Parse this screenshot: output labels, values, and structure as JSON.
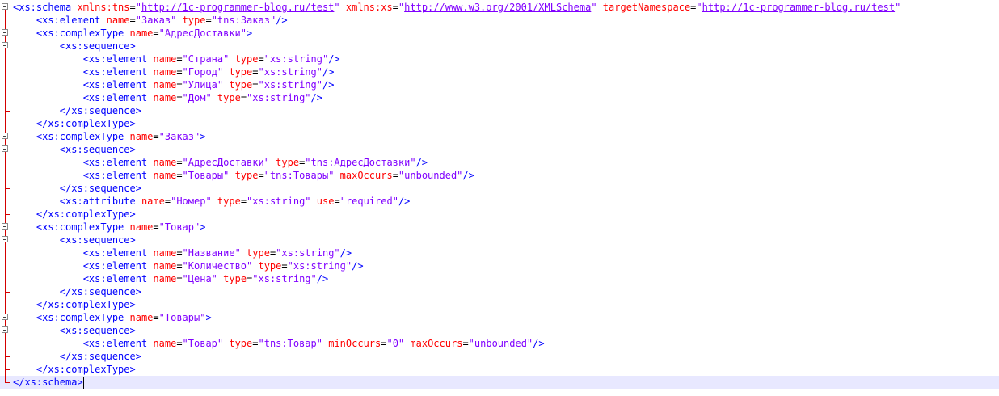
{
  "lines": [
    {
      "fold": "box-top",
      "indent": 0,
      "parts": [
        [
          "tag",
          "<xs:schema "
        ],
        [
          "attr",
          "xmlns:tns"
        ],
        [
          "eq",
          "="
        ],
        [
          "val",
          "\""
        ],
        [
          "url",
          "http://1c-programmer-blog.ru/test"
        ],
        [
          "val",
          "\""
        ],
        [
          "tag",
          " "
        ],
        [
          "attr",
          "xmlns:xs"
        ],
        [
          "eq",
          "="
        ],
        [
          "val",
          "\""
        ],
        [
          "url",
          "http://www.w3.org/2001/XMLSchema"
        ],
        [
          "val",
          "\""
        ],
        [
          "tag",
          " "
        ],
        [
          "attr",
          "targetNamespace"
        ],
        [
          "eq",
          "="
        ],
        [
          "val",
          "\""
        ],
        [
          "url",
          "http://1c-programmer-blog.ru/test"
        ],
        [
          "val",
          "\""
        ]
      ]
    },
    {
      "fold": "line",
      "indent": 4,
      "parts": [
        [
          "tag",
          "<xs:element "
        ],
        [
          "attr",
          "name"
        ],
        [
          "eq",
          "="
        ],
        [
          "val",
          "\"Заказ\""
        ],
        [
          "tag",
          " "
        ],
        [
          "attr",
          "type"
        ],
        [
          "eq",
          "="
        ],
        [
          "val",
          "\"tns:Заказ\""
        ],
        [
          "tag",
          "/>"
        ]
      ]
    },
    {
      "fold": "box",
      "indent": 4,
      "parts": [
        [
          "tag",
          "<xs:complexType "
        ],
        [
          "attr",
          "name"
        ],
        [
          "eq",
          "="
        ],
        [
          "val",
          "\"АдресДоставки\""
        ],
        [
          "tag",
          ">"
        ]
      ]
    },
    {
      "fold": "box",
      "indent": 8,
      "parts": [
        [
          "tag",
          "<xs:sequence>"
        ]
      ]
    },
    {
      "fold": "line",
      "indent": 12,
      "parts": [
        [
          "tag",
          "<xs:element "
        ],
        [
          "attr",
          "name"
        ],
        [
          "eq",
          "="
        ],
        [
          "val",
          "\"Страна\""
        ],
        [
          "tag",
          " "
        ],
        [
          "attr",
          "type"
        ],
        [
          "eq",
          "="
        ],
        [
          "val",
          "\"xs:string\""
        ],
        [
          "tag",
          "/>"
        ]
      ]
    },
    {
      "fold": "line",
      "indent": 12,
      "parts": [
        [
          "tag",
          "<xs:element "
        ],
        [
          "attr",
          "name"
        ],
        [
          "eq",
          "="
        ],
        [
          "val",
          "\"Город\""
        ],
        [
          "tag",
          " "
        ],
        [
          "attr",
          "type"
        ],
        [
          "eq",
          "="
        ],
        [
          "val",
          "\"xs:string\""
        ],
        [
          "tag",
          "/>"
        ]
      ]
    },
    {
      "fold": "line",
      "indent": 12,
      "parts": [
        [
          "tag",
          "<xs:element "
        ],
        [
          "attr",
          "name"
        ],
        [
          "eq",
          "="
        ],
        [
          "val",
          "\"Улица\""
        ],
        [
          "tag",
          " "
        ],
        [
          "attr",
          "type"
        ],
        [
          "eq",
          "="
        ],
        [
          "val",
          "\"xs:string\""
        ],
        [
          "tag",
          "/>"
        ]
      ]
    },
    {
      "fold": "line",
      "indent": 12,
      "parts": [
        [
          "tag",
          "<xs:element "
        ],
        [
          "attr",
          "name"
        ],
        [
          "eq",
          "="
        ],
        [
          "val",
          "\"Дом\""
        ],
        [
          "tag",
          " "
        ],
        [
          "attr",
          "type"
        ],
        [
          "eq",
          "="
        ],
        [
          "val",
          "\"xs:string\""
        ],
        [
          "tag",
          "/>"
        ]
      ]
    },
    {
      "fold": "end",
      "indent": 8,
      "parts": [
        [
          "tag",
          "</xs:sequence>"
        ]
      ]
    },
    {
      "fold": "end",
      "indent": 4,
      "parts": [
        [
          "tag",
          "</xs:complexType>"
        ]
      ]
    },
    {
      "fold": "box",
      "indent": 4,
      "parts": [
        [
          "tag",
          "<xs:complexType "
        ],
        [
          "attr",
          "name"
        ],
        [
          "eq",
          "="
        ],
        [
          "val",
          "\"Заказ\""
        ],
        [
          "tag",
          ">"
        ]
      ]
    },
    {
      "fold": "box",
      "indent": 8,
      "parts": [
        [
          "tag",
          "<xs:sequence>"
        ]
      ]
    },
    {
      "fold": "line",
      "indent": 12,
      "parts": [
        [
          "tag",
          "<xs:element "
        ],
        [
          "attr",
          "name"
        ],
        [
          "eq",
          "="
        ],
        [
          "val",
          "\"АдресДоставки\""
        ],
        [
          "tag",
          " "
        ],
        [
          "attr",
          "type"
        ],
        [
          "eq",
          "="
        ],
        [
          "val",
          "\"tns:АдресДоставки\""
        ],
        [
          "tag",
          "/>"
        ]
      ]
    },
    {
      "fold": "line",
      "indent": 12,
      "parts": [
        [
          "tag",
          "<xs:element "
        ],
        [
          "attr",
          "name"
        ],
        [
          "eq",
          "="
        ],
        [
          "val",
          "\"Товары\""
        ],
        [
          "tag",
          " "
        ],
        [
          "attr",
          "type"
        ],
        [
          "eq",
          "="
        ],
        [
          "val",
          "\"tns:Товары\""
        ],
        [
          "tag",
          " "
        ],
        [
          "attr",
          "maxOccurs"
        ],
        [
          "eq",
          "="
        ],
        [
          "val",
          "\"unbounded\""
        ],
        [
          "tag",
          "/>"
        ]
      ]
    },
    {
      "fold": "end",
      "indent": 8,
      "parts": [
        [
          "tag",
          "</xs:sequence>"
        ]
      ]
    },
    {
      "fold": "line",
      "indent": 8,
      "parts": [
        [
          "tag",
          "<xs:attribute "
        ],
        [
          "attr",
          "name"
        ],
        [
          "eq",
          "="
        ],
        [
          "val",
          "\"Номер\""
        ],
        [
          "tag",
          " "
        ],
        [
          "attr",
          "type"
        ],
        [
          "eq",
          "="
        ],
        [
          "val",
          "\"xs:string\""
        ],
        [
          "tag",
          " "
        ],
        [
          "attr",
          "use"
        ],
        [
          "eq",
          "="
        ],
        [
          "val",
          "\"required\""
        ],
        [
          "tag",
          "/>"
        ]
      ]
    },
    {
      "fold": "end",
      "indent": 4,
      "parts": [
        [
          "tag",
          "</xs:complexType>"
        ]
      ]
    },
    {
      "fold": "box",
      "indent": 4,
      "parts": [
        [
          "tag",
          "<xs:complexType "
        ],
        [
          "attr",
          "name"
        ],
        [
          "eq",
          "="
        ],
        [
          "val",
          "\"Товар\""
        ],
        [
          "tag",
          ">"
        ]
      ]
    },
    {
      "fold": "box",
      "indent": 8,
      "parts": [
        [
          "tag",
          "<xs:sequence>"
        ]
      ]
    },
    {
      "fold": "line",
      "indent": 12,
      "parts": [
        [
          "tag",
          "<xs:element "
        ],
        [
          "attr",
          "name"
        ],
        [
          "eq",
          "="
        ],
        [
          "val",
          "\"Название\""
        ],
        [
          "tag",
          " "
        ],
        [
          "attr",
          "type"
        ],
        [
          "eq",
          "="
        ],
        [
          "val",
          "\"xs:string\""
        ],
        [
          "tag",
          "/>"
        ]
      ]
    },
    {
      "fold": "line",
      "indent": 12,
      "parts": [
        [
          "tag",
          "<xs:element "
        ],
        [
          "attr",
          "name"
        ],
        [
          "eq",
          "="
        ],
        [
          "val",
          "\"Количество\""
        ],
        [
          "tag",
          " "
        ],
        [
          "attr",
          "type"
        ],
        [
          "eq",
          "="
        ],
        [
          "val",
          "\"xs:string\""
        ],
        [
          "tag",
          "/>"
        ]
      ]
    },
    {
      "fold": "line",
      "indent": 12,
      "parts": [
        [
          "tag",
          "<xs:element "
        ],
        [
          "attr",
          "name"
        ],
        [
          "eq",
          "="
        ],
        [
          "val",
          "\"Цена\""
        ],
        [
          "tag",
          " "
        ],
        [
          "attr",
          "type"
        ],
        [
          "eq",
          "="
        ],
        [
          "val",
          "\"xs:string\""
        ],
        [
          "tag",
          "/>"
        ]
      ]
    },
    {
      "fold": "end",
      "indent": 8,
      "parts": [
        [
          "tag",
          "</xs:sequence>"
        ]
      ]
    },
    {
      "fold": "end",
      "indent": 4,
      "parts": [
        [
          "tag",
          "</xs:complexType>"
        ]
      ]
    },
    {
      "fold": "box",
      "indent": 4,
      "parts": [
        [
          "tag",
          "<xs:complexType "
        ],
        [
          "attr",
          "name"
        ],
        [
          "eq",
          "="
        ],
        [
          "val",
          "\"Товары\""
        ],
        [
          "tag",
          ">"
        ]
      ]
    },
    {
      "fold": "box",
      "indent": 8,
      "parts": [
        [
          "tag",
          "<xs:sequence>"
        ]
      ]
    },
    {
      "fold": "line",
      "indent": 12,
      "parts": [
        [
          "tag",
          "<xs:element "
        ],
        [
          "attr",
          "name"
        ],
        [
          "eq",
          "="
        ],
        [
          "val",
          "\"Товар\""
        ],
        [
          "tag",
          " "
        ],
        [
          "attr",
          "type"
        ],
        [
          "eq",
          "="
        ],
        [
          "val",
          "\"tns:Товар\""
        ],
        [
          "tag",
          " "
        ],
        [
          "attr",
          "minOccurs"
        ],
        [
          "eq",
          "="
        ],
        [
          "val",
          "\"0\""
        ],
        [
          "tag",
          " "
        ],
        [
          "attr",
          "maxOccurs"
        ],
        [
          "eq",
          "="
        ],
        [
          "val",
          "\"unbounded\""
        ],
        [
          "tag",
          "/>"
        ]
      ]
    },
    {
      "fold": "end",
      "indent": 8,
      "parts": [
        [
          "tag",
          "</xs:sequence>"
        ]
      ]
    },
    {
      "fold": "end",
      "indent": 4,
      "parts": [
        [
          "tag",
          "</xs:complexType>"
        ]
      ]
    },
    {
      "fold": "last",
      "indent": 0,
      "current": true,
      "parts": [
        [
          "tag",
          "</xs:schema>"
        ]
      ]
    }
  ],
  "colors": {
    "tag": "#0000ff",
    "attr": "#ff0000",
    "value": "#8000ff",
    "current_line": "#e8e8ff",
    "fold_line": "#d40000"
  }
}
